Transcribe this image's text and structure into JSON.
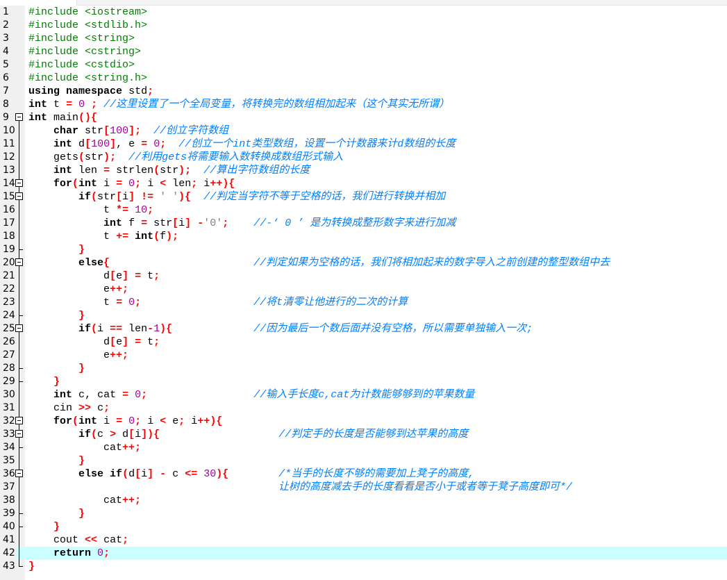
{
  "editor": {
    "current_line": 42,
    "colors": {
      "preprocessor": "#008000",
      "keyword": "#000000",
      "operator": "#ff0000",
      "number": "#a000a0",
      "comment": "#0080ff",
      "current_line_bg": "#ccffff",
      "gutter_bg": "#f0f0f0"
    },
    "fold_open_lines": [
      9,
      14,
      15,
      20,
      25,
      32,
      33,
      36
    ],
    "fold_close_lines": [
      19,
      24,
      28,
      29,
      34,
      39,
      40,
      43
    ],
    "lines": [
      "#include <iostream>",
      "#include <stdlib.h>",
      "#include <string>",
      "#include <cstring>",
      "#include <cstdio>",
      "#include <string.h>",
      "using namespace std;",
      "int t = 0 ; //这里设置了一个全局变量，将转换完的数组相加起来（这个其实无所谓）",
      "int main(){",
      "    char str[100];  //创立字符数组",
      "    int d[100], e = 0;  //创立一个int类型数组，设置一个计数器来计d数组的长度",
      "    gets(str);  //利用gets将需要输入数转换成数组形式输入",
      "    int len = strlen(str);  //算出字符数组的长度",
      "    for(int i = 0; i < len; i++){",
      "        if(str[i] != ' '){  //判定当字符不等于空格的话，我们进行转换并相加",
      "            t *= 10;",
      "            int f = str[i] -'0';    //-‘ 0 ’ 是为转换成整形数字来进行加减",
      "            t += int(f);",
      "        }",
      "        else{                       //判定如果为空格的话，我们将相加起来的数字导入之前创建的整型数组中去",
      "            d[e] = t;",
      "            e++;",
      "            t = 0;                  //将t清零让他进行的二次的计算",
      "        }",
      "        if(i == len-1){             //因为最后一个数后面并没有空格，所以需要单独输入一次;",
      "            d[e] = t;",
      "            e++;",
      "        }",
      "    }",
      "    int c, cat = 0;                 //输入手长度c,cat为计数能够够到的苹果数量",
      "    cin >> c;",
      "    for(int i = 0; i < e; i++){",
      "        if(c > d[i]){                   //判定手的长度是否能够到达苹果的高度",
      "            cat++;",
      "        }",
      "        else if(d[i] - c <= 30){        /*当手的长度不够的需要加上凳子的高度,",
      "                                        让树的高度减去手的长度看看是否小于或者等于凳子高度即可*/",
      "            cat++;",
      "        }",
      "    }",
      "    cout << cat;",
      "    return 0;",
      "}"
    ]
  }
}
